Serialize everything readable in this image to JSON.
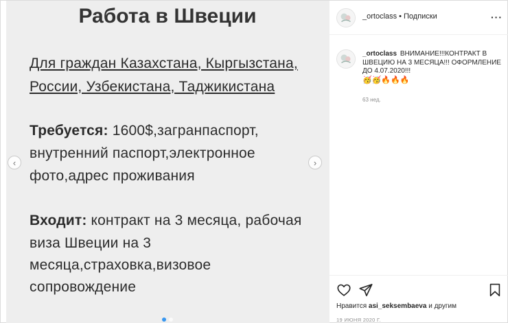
{
  "media": {
    "title": "Работа в Швеции",
    "lines": [
      "Для граждан Казахстана, Кыргызстана,",
      "России, Узбекистана, Таджикистана",
      "Требуется:",
      " 1600$,загранпаспорт,",
      "внутренний паспорт,электронное",
      "фото,адрес проживания",
      "Входит:",
      " контракт на 3 месяца, рабочая",
      "виза Швеции на 3",
      "месяца,страховка,визовое",
      "сопровождение"
    ],
    "prev_glyph": "‹",
    "next_glyph": "›"
  },
  "header": {
    "username": "_ortoclass",
    "separator": "•",
    "follow_label": "Подписки",
    "more_glyph": "···"
  },
  "caption": {
    "username": "_ortoclass",
    "text": "ВНИМАНИЕ!!!КОНТРАКТ В ШВЕЦИЮ НА 3 МЕСЯЦА!!! ОФОРМЛЕНИЕ ДО 4.07.2020!!!",
    "emojis": "🥳🥳🔥🔥🔥",
    "time_ago": "63 нед."
  },
  "actions": {
    "icons": [
      "heart-icon",
      "share-icon",
      "bookmark-icon"
    ],
    "likes_prefix": "Нравится ",
    "likes_user": "asi_seksembaeva",
    "likes_suffix": " и другим",
    "date": "19 ИЮНЯ 2020 Г."
  },
  "colors": {
    "accent": "#3897f0",
    "media_bg": "#eeeeee",
    "muted": "#8e8e8e"
  }
}
